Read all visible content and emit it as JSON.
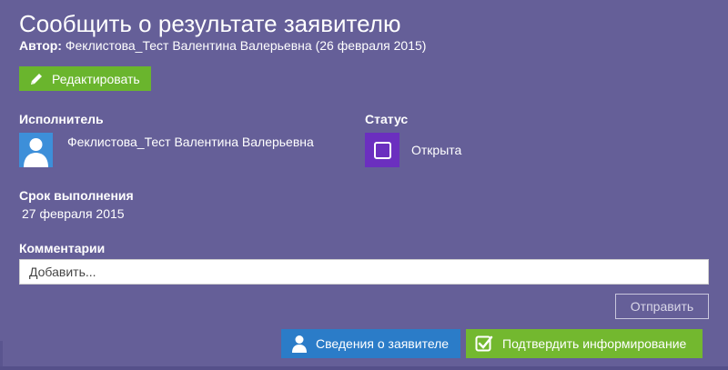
{
  "header": {
    "title": "Сообщить о результате заявителю",
    "author_label": "Автор:",
    "author_value": "Феклистова_Тест Валентина Валерьевна (26 февраля 2015)"
  },
  "toolbar": {
    "edit_label": "Редактировать",
    "edit_icon": "pencil-icon"
  },
  "executor": {
    "label": "Исполнитель",
    "name": "Феклистова_Тест Валентина Валерьевна",
    "avatar_icon": "user-avatar-icon"
  },
  "status": {
    "label": "Статус",
    "value": "Открыта",
    "icon": "checkbox-empty-icon",
    "color": "#6b2fbf"
  },
  "due": {
    "label": "Срок выполнения",
    "value": "27 февраля 2015"
  },
  "comments": {
    "label": "Комментарии",
    "placeholder": "Добавить...",
    "value": "",
    "send_label": "Отправить"
  },
  "actions": {
    "applicant_label": "Сведения о заявителе",
    "applicant_icon": "person-icon",
    "confirm_label": "Подтвердить информирование",
    "confirm_icon": "checkbox-checked-icon"
  },
  "colors": {
    "background": "#655f98",
    "green": "#6ab52d",
    "blue": "#2b7cc8"
  }
}
